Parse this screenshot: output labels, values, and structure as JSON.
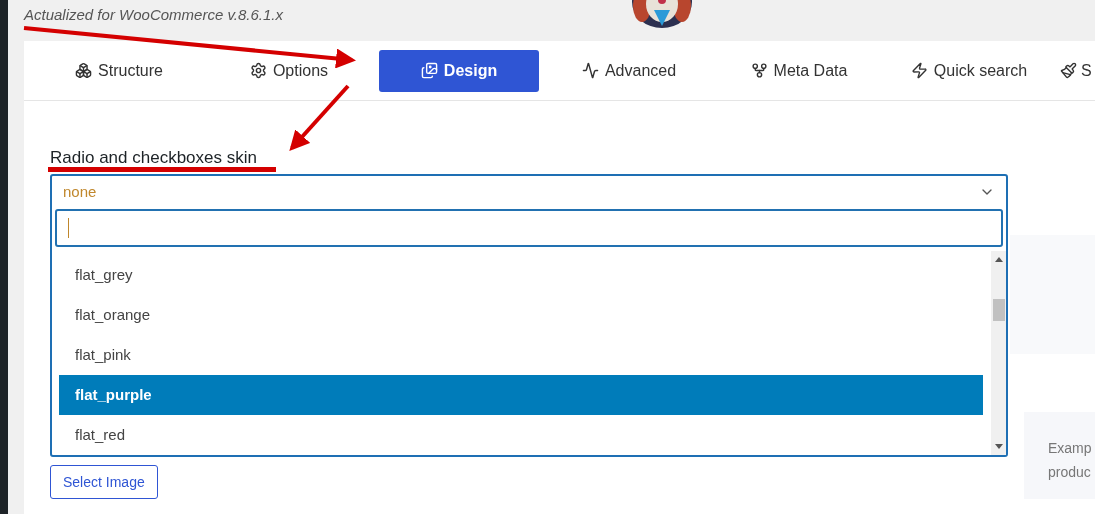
{
  "header": {
    "note": "Actualized for WooCommerce v.8.6.1.x"
  },
  "tabs": [
    {
      "label": "Structure",
      "selected": false
    },
    {
      "label": "Options",
      "selected": false
    },
    {
      "label": "Design",
      "selected": true
    },
    {
      "label": "Advanced",
      "selected": false
    },
    {
      "label": "Meta Data",
      "selected": false
    },
    {
      "label": "Quick search",
      "selected": false
    },
    {
      "label": "S",
      "selected": false
    }
  ],
  "field": {
    "label": "Radio and checkboxes skin",
    "value": "none"
  },
  "options": [
    {
      "label": "flat_grey",
      "selected": false
    },
    {
      "label": "flat_orange",
      "selected": false
    },
    {
      "label": "flat_pink",
      "selected": false
    },
    {
      "label": "flat_purple",
      "selected": true
    },
    {
      "label": "flat_red",
      "selected": false
    }
  ],
  "button": "Select Image",
  "side_panel": {
    "lines": [
      "Examp",
      "produc"
    ]
  }
}
